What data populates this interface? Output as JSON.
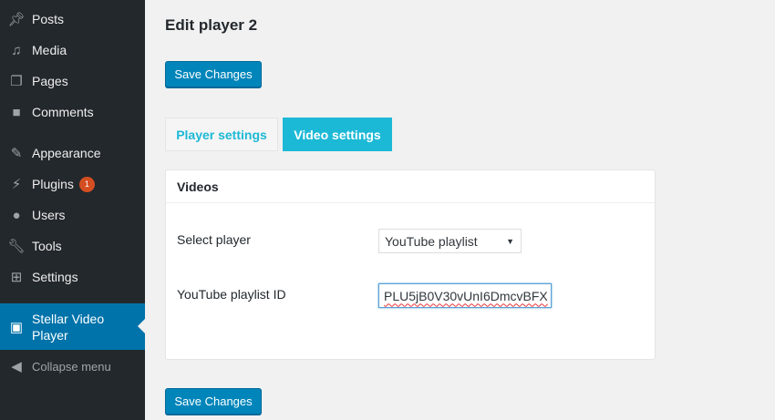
{
  "sidebar": {
    "items": [
      {
        "label": "Posts",
        "icon": "pin-icon"
      },
      {
        "label": "Media",
        "icon": "media-icon"
      },
      {
        "label": "Pages",
        "icon": "pages-icon"
      },
      {
        "label": "Comments",
        "icon": "comment-icon"
      },
      {
        "label": "Appearance",
        "icon": "brush-icon"
      },
      {
        "label": "Plugins",
        "icon": "plugin-icon",
        "badge": "1"
      },
      {
        "label": "Users",
        "icon": "user-icon"
      },
      {
        "label": "Tools",
        "icon": "wrench-icon"
      },
      {
        "label": "Settings",
        "icon": "sliders-icon"
      },
      {
        "label": "Stellar Video Player",
        "icon": "video-icon",
        "active": true
      }
    ],
    "collapse_label": "Collapse menu"
  },
  "page": {
    "title": "Edit player 2",
    "save_label": "Save Changes"
  },
  "tabs": [
    {
      "label": "Player settings"
    },
    {
      "label": "Video settings",
      "active": true
    }
  ],
  "panel": {
    "title": "Videos",
    "select_label": "Select player",
    "select_value": "YouTube playlist",
    "playlist_label": "YouTube playlist ID",
    "playlist_value": "PLU5jB0V30vUnI6DmcvBFX"
  },
  "colors": {
    "sidebar": "#23282d",
    "active": "#0073aa",
    "tab": "#1cb9d6",
    "button": "#0085ba",
    "badge": "#d54e21"
  }
}
